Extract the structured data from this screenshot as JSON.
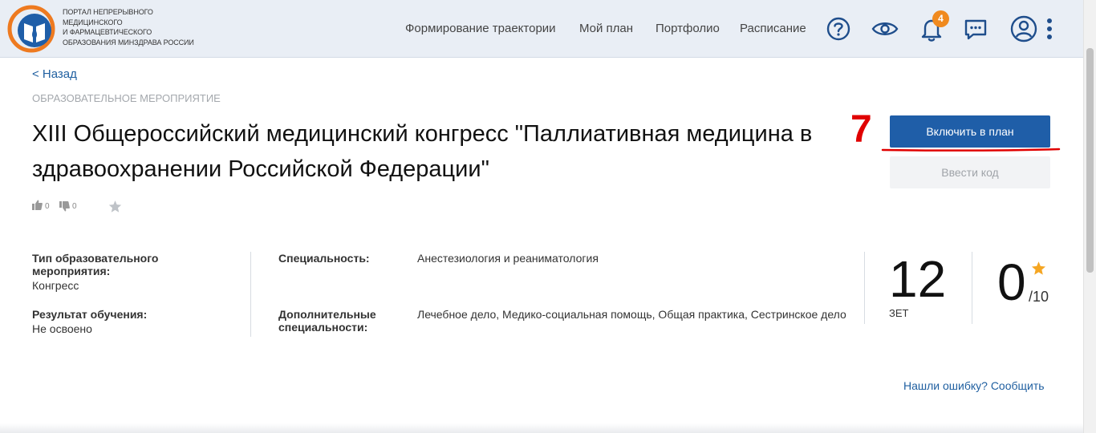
{
  "header": {
    "logo_lines": [
      "Портал непрерывного",
      "медицинского",
      "и фармацевтического",
      "образования Минздрава России"
    ],
    "nav": [
      "Формирование траектории",
      "Мой план",
      "Портфолио",
      "Расписание"
    ],
    "notifications_count": "4",
    "icons": [
      "help-icon",
      "eye-icon",
      "bell-icon",
      "chat-icon",
      "user-icon",
      "more-vertical-icon"
    ],
    "brand_color": "#1f5ea8",
    "badge_color": "#f08a1f"
  },
  "page": {
    "back_label": "< Назад",
    "category": "ОБРАЗОВАТЕЛЬНОЕ МЕРОПРИЯТИЕ",
    "title": "XIII Общероссийский медицинский конгресс \"Паллиативная медицина в здравоохранении Российской Федерации\"",
    "likes": "0",
    "dislikes": "0",
    "step_marker": "7",
    "primary_button": "Включить в план",
    "secondary_button": "Ввести код"
  },
  "details": {
    "type_label": "Тип образовательного мероприятия:",
    "type_value": "Конгресс",
    "result_label": "Результат обучения:",
    "result_value": "Не освоено",
    "specialty_label": "Специальность:",
    "specialty_value": "Анестезиология и реаниматология",
    "extra_specialty_label": "Дополнительные специальности:",
    "extra_specialty_value": "Лечебное дело, Медико-социальная помощь, Общая практика, Сестринское дело"
  },
  "stats": {
    "credits_value": "12",
    "credits_unit": "ЗЕТ",
    "rating_value": "0",
    "rating_max": "/10",
    "star_color": "#f5a623"
  },
  "footer": {
    "report_link": "Нашли ошибку? Сообщить"
  }
}
